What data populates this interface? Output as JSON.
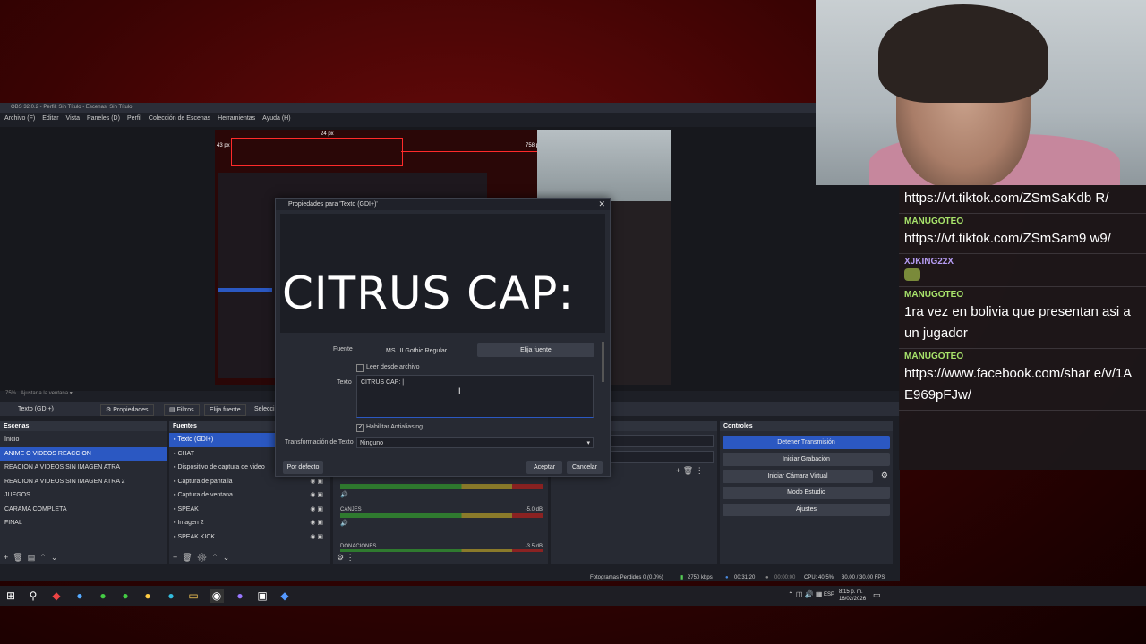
{
  "obs": {
    "title": "OBS 32.0.2 - Perfil: Sin Título - Escenas: Sin Título",
    "menu": [
      "Archivo (F)",
      "Editar",
      "Vista",
      "Paneles (D)",
      "Perfil",
      "Colección de Escenas",
      "Herramientas",
      "Ayuda (H)"
    ],
    "preview": {
      "dim_top": "24 px",
      "dim_left": "43 px",
      "dim_right": "758 px"
    },
    "zoom": "75%",
    "zoom_label": "Ajustar a la ventana",
    "toolbar": {
      "source": "Texto (GDI+)",
      "properties": "Propiedades",
      "filters": "Filtros",
      "choose_font": "Elija fuente",
      "select": "Selecci"
    },
    "scenes": {
      "header": "Escenas",
      "items": [
        "Inicio",
        "ANIME O VIDEOS REACCION",
        "REACION A VIDEOS SIN IMAGEN ATRA",
        "REACION A VIDEOS SIN IMAGEN ATRA 2",
        "JUEGOS",
        "CARAMA COMPLETA",
        "FINAL"
      ],
      "selected": 1
    },
    "sources": {
      "header": "Fuentes",
      "items": [
        "Texto (GDI+)",
        "CHAT",
        "Dispositivo de captura de video",
        "Captura de pantalla",
        "Captura de ventana",
        "SPEAK",
        "Imagen 2",
        "SPEAK KICK"
      ],
      "selected": 0
    },
    "mixer": {
      "tracks": [
        {
          "name": "",
          "level": ""
        },
        {
          "name": "CANJES",
          "level": "-5.0 dB"
        },
        {
          "name": "DONACIONES",
          "level": "-3.5 dB"
        }
      ]
    },
    "transitions_header": "scena",
    "controls": {
      "header": "Controles",
      "buttons": [
        "Detener Transmisión",
        "Iniciar Grabación",
        "Iniciar Cámara Virtual",
        "Modo Estudio",
        "Ajustes"
      ]
    },
    "status": {
      "dropped": "Fotogramas Perdidos 0 (0.0%)",
      "bitrate": "2750 kbps",
      "live_time": "00:31:20",
      "rec_time": "00:00:00",
      "cpu": "CPU: 40.5%",
      "fps": "30.00 / 30.00 FPS"
    }
  },
  "dialog": {
    "title": "Propiedades para 'Texto (GDI+)'",
    "preview_text": "CITRUS CAP:",
    "font_label": "Fuente",
    "font_value": "MS UI Gothic Regular",
    "choose_font": "Elija fuente",
    "read_file_label": "Leer desde archivo",
    "text_label": "Texto",
    "text_value": "CITRUS CAP: |",
    "antialias_label": "Habilitar Antialiasing",
    "transform_label": "Transformación de Texto",
    "transform_value": "Ninguno",
    "defaults": "Por defecto",
    "accept": "Aceptar",
    "cancel": "Cancelar"
  },
  "chat": {
    "messages": [
      {
        "user": "",
        "text": "https://vt.tiktok.com/ZSmSaKdb R/"
      },
      {
        "user": "MANUGOTEO",
        "text": "https://vt.tiktok.com/ZSmSam9 w9/"
      },
      {
        "user": "XJKING22X",
        "text": ""
      },
      {
        "user": "MANUGOTEO",
        "text": "1ra vez en bolivia que presentan asi a un jugador"
      },
      {
        "user": "MANUGOTEO",
        "text": "https://www.facebook.com/shar e/v/1AE969pFJw/"
      }
    ]
  },
  "taskbar": {
    "clock_time": "8:15 p. m.",
    "clock_date": "16/02/2026",
    "lang": "ESP"
  }
}
